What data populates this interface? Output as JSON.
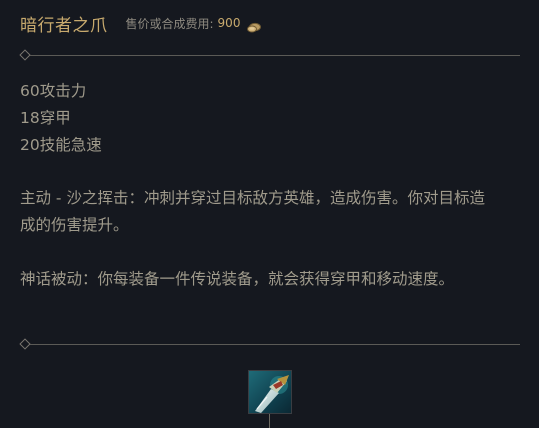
{
  "item": {
    "name": "暗行者之爪",
    "cost_label": "售价或合成费用:",
    "cost_value": "900",
    "gold_icon": "gold-coins-icon",
    "icon": "blade-claw-icon"
  },
  "stats": [
    "60攻击力",
    "18穿甲",
    "20技能急速"
  ],
  "active_description": "主动 - 沙之挥击：冲刺并穿过目标敌方英雄，造成伤害。你对目标造成的伤害提升。",
  "passive_description": "神话被动：你每装备一件传说装备，就会获得穿甲和移动速度。",
  "colors": {
    "background": "#15181f",
    "name_gold": "#c8aa6e",
    "body_text": "#a09b8c",
    "divider": "#5b5a56"
  }
}
